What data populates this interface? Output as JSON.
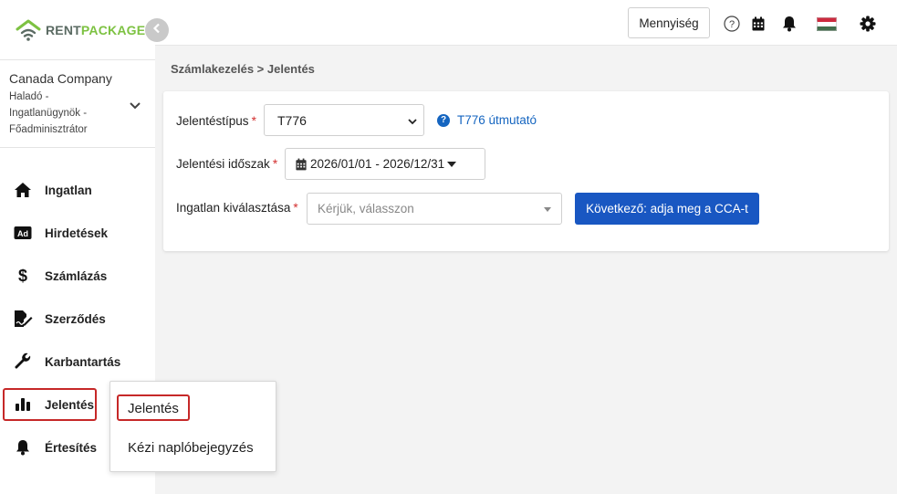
{
  "brand": {
    "rent": "RENT",
    "package": "PACKAGE"
  },
  "company": {
    "name": "Canada Company",
    "role": "Haladó - Ingatlanügynök - Főadminisztrátor"
  },
  "nav": {
    "items": [
      {
        "label": "Ingatlan",
        "icon": "home-icon"
      },
      {
        "label": "Hirdetések",
        "icon": "ad-icon"
      },
      {
        "label": "Számlázás",
        "icon": "dollar-icon"
      },
      {
        "label": "Szerződés",
        "icon": "contract-icon"
      },
      {
        "label": "Karbantartás",
        "icon": "wrench-icon"
      },
      {
        "label": "Jelentés",
        "icon": "bar-chart-icon"
      },
      {
        "label": "Értesítés",
        "icon": "bell-icon"
      }
    ]
  },
  "topbar": {
    "quantity_label": "Mennyiség"
  },
  "breadcrumb": "Számlakezelés > Jelentés",
  "form": {
    "report_type_label": "Jelentéstípus",
    "report_type_value": "T776",
    "guide_link": "T776 útmutató",
    "period_label": "Jelentési időszak",
    "period_value": "2026/01/01 - 2026/12/31",
    "property_label": "Ingatlan kiválasztása",
    "property_placeholder": "Kérjük, válasszon",
    "required_mark": "*",
    "next_button": "Következő: adja meg a CCA-t"
  },
  "submenu": {
    "items": [
      "Jelentés",
      "Kézi naplóbejegyzés"
    ]
  },
  "colors": {
    "accent": "#1957c2",
    "highlight": "#c62828",
    "brand_green": "#7dc242"
  }
}
